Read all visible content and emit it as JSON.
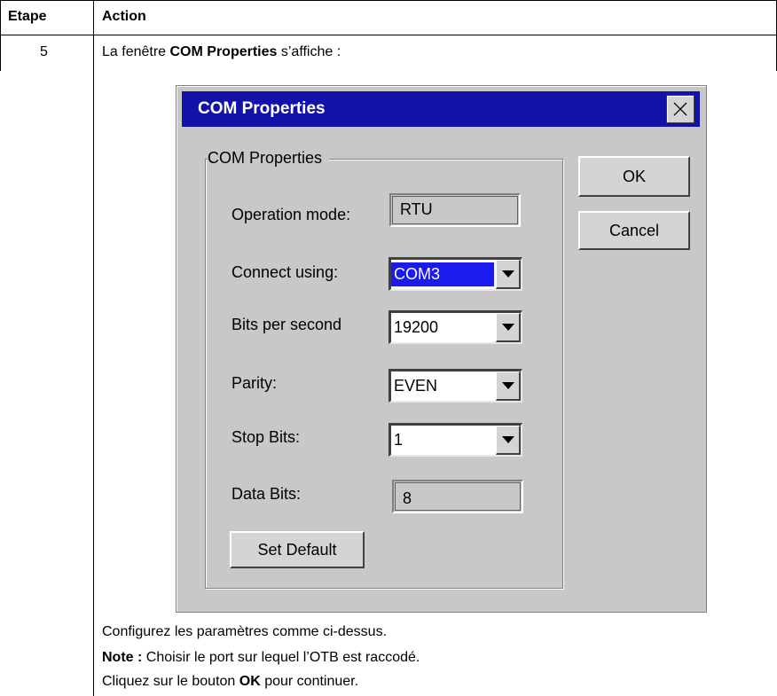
{
  "table": {
    "header_step": "Etape",
    "header_action": "Action",
    "step_number": "5"
  },
  "intro": {
    "prefix": "La fenêtre ",
    "bold": "COM Properties",
    "suffix": " s’affiche :"
  },
  "dialog": {
    "title": "COM Properties",
    "group_label": "COM Properties",
    "ok_label": "OK",
    "cancel_label": "Cancel",
    "set_default_label": "Set Default",
    "fields": {
      "operation_mode": {
        "label": "Operation mode:",
        "value": "RTU"
      },
      "connect_using": {
        "label": "Connect using:",
        "value": "COM3"
      },
      "bits_per_second": {
        "label": "Bits per second",
        "value": "19200"
      },
      "parity": {
        "label": "Parity:",
        "value": "EVEN"
      },
      "stop_bits": {
        "label": "Stop Bits:",
        "value": "1"
      },
      "data_bits": {
        "label": "Data Bits:",
        "value": "8"
      }
    }
  },
  "notes": {
    "line1": "Configurez les paramètres comme ci-dessus.",
    "note_bold": "Note :",
    "note_text": " Choisir le port sur lequel l’OTB est raccodé.",
    "line3_prefix": "Cliquez sur le bouton ",
    "line3_bold": "OK",
    "line3_suffix": " pour continuer."
  }
}
